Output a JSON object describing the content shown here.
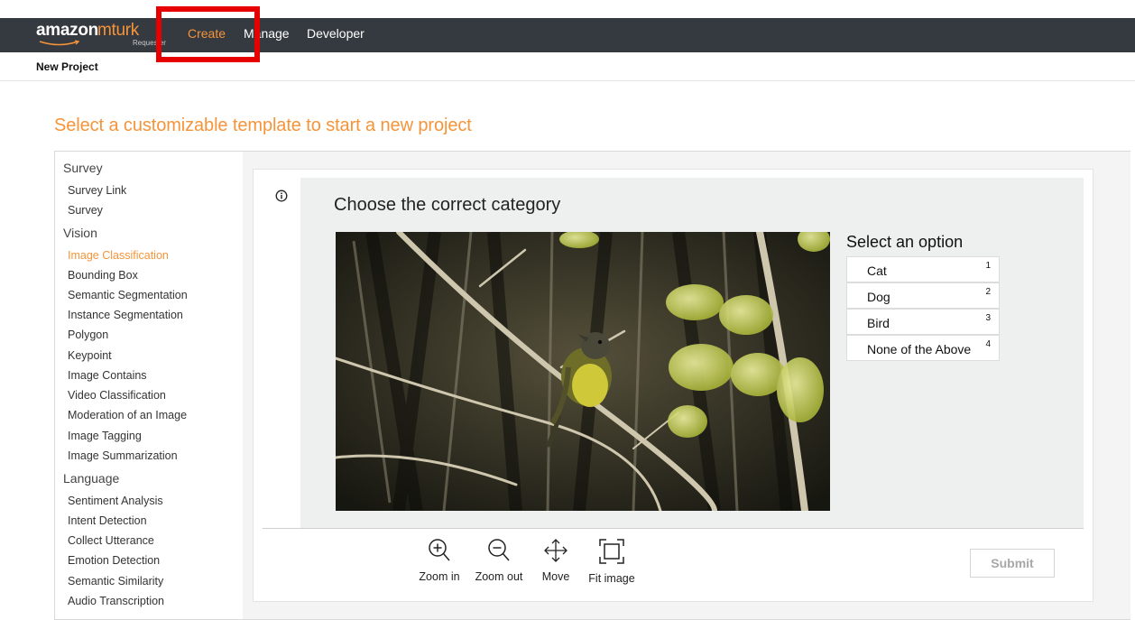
{
  "header": {
    "logo_word": "amazon",
    "logo_product": "mturk",
    "logo_sub": "Requester",
    "nav": {
      "create": "Create",
      "manage": "Manage",
      "developer": "Developer"
    }
  },
  "subheader": {
    "title": "New Project"
  },
  "heading": "Select a customizable template to start a new project",
  "sidebar": {
    "groups": [
      {
        "label": "Survey",
        "items": [
          "Survey Link",
          "Survey"
        ]
      },
      {
        "label": "Vision",
        "items": [
          "Image Classification",
          "Bounding Box",
          "Semantic Segmentation",
          "Instance Segmentation",
          "Polygon",
          "Keypoint",
          "Image Contains",
          "Video Classification",
          "Moderation of an Image",
          "Image Tagging",
          "Image Summarization"
        ]
      },
      {
        "label": "Language",
        "items": [
          "Sentiment Analysis",
          "Intent Detection",
          "Collect Utterance",
          "Emotion Detection",
          "Semantic Similarity",
          "Audio Transcription"
        ]
      }
    ],
    "active_item": "Image Classification"
  },
  "task": {
    "title": "Choose the correct category",
    "options_title": "Select an option",
    "options": [
      {
        "label": "Cat",
        "key": "1"
      },
      {
        "label": "Dog",
        "key": "2"
      },
      {
        "label": "Bird",
        "key": "3"
      },
      {
        "label": "None of the Above",
        "key": "4"
      }
    ]
  },
  "tools": {
    "zoom_in": "Zoom in",
    "zoom_out": "Zoom out",
    "move": "Move",
    "fit_image": "Fit image"
  },
  "submit_label": "Submit",
  "colors": {
    "accent": "#f6943a",
    "topbar": "#353a40",
    "highlight": "#e60000"
  }
}
